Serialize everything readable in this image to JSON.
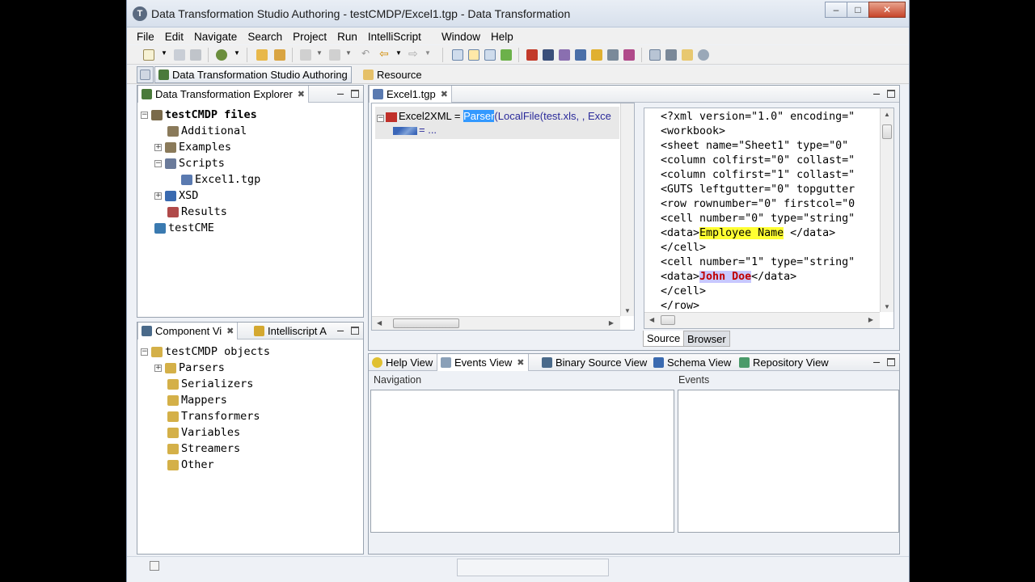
{
  "window": {
    "title": "Data Transformation Studio Authoring - testCMDP/Excel1.tgp - Data Transformation",
    "app_icon_letter": "T"
  },
  "menu": [
    "File",
    "Edit",
    "Navigate",
    "Search",
    "Project",
    "Run",
    "IntelliScript",
    "Window",
    "Help"
  ],
  "perspectives": {
    "active": "Data Transformation Studio Authoring",
    "other": "Resource"
  },
  "explorer": {
    "tab": "Data Transformation Explorer",
    "root": "testCMDP files",
    "items": [
      "Additional",
      "Examples",
      "Scripts",
      "Excel1.tgp",
      "XSD",
      "Results"
    ],
    "project2": "testCME"
  },
  "component": {
    "tab1": "Component Vi",
    "tab2": "Intelliscript A",
    "root": "testCMDP objects",
    "items": [
      "Parsers",
      "Serializers",
      "Mappers",
      "Transformers",
      "Variables",
      "Streamers",
      "Other"
    ]
  },
  "editor": {
    "tab": "Excel1.tgp",
    "line1_name": "Excel2XML",
    "line1_eq": " = ",
    "line1_component": "Parser",
    "line1_rest": "(LocalFile(test.xls, , Exce",
    "line2": "= ..."
  },
  "xml": {
    "lines": [
      "<?xml version=\"1.0\" encoding=\"",
      "<workbook>",
      "<sheet name=\"Sheet1\" type=\"0\"",
      "<column colfirst=\"0\" collast=\"",
      "<column colfirst=\"1\" collast=\"",
      "<GUTS leftgutter=\"0\" topgutter",
      "<row rownumber=\"0\" firstcol=\"0",
      "<cell number=\"0\" type=\"string\""
    ],
    "data1_open": "<data>",
    "data1_value": "Employee Name",
    "data1_close": " </data>",
    "cell_close_1": "</cell>",
    "cell2": "<cell number=\"1\" type=\"string\"",
    "data2_open": "<data>",
    "data2_value": "John Doe",
    "data2_close": "</data>",
    "cell_close_2": "</cell>",
    "row_close": "</row>",
    "tab_source": "Source",
    "tab_browser": "Browser"
  },
  "bottom": {
    "tabs": [
      "Help View",
      "Events View",
      "Binary Source View",
      "Schema View",
      "Repository View"
    ],
    "navigation_label": "Navigation",
    "events_label": "Events"
  },
  "colors": {
    "accent": "#3399ff",
    "highlight_yellow": "#ffff33",
    "highlight_value": "#c00000"
  }
}
